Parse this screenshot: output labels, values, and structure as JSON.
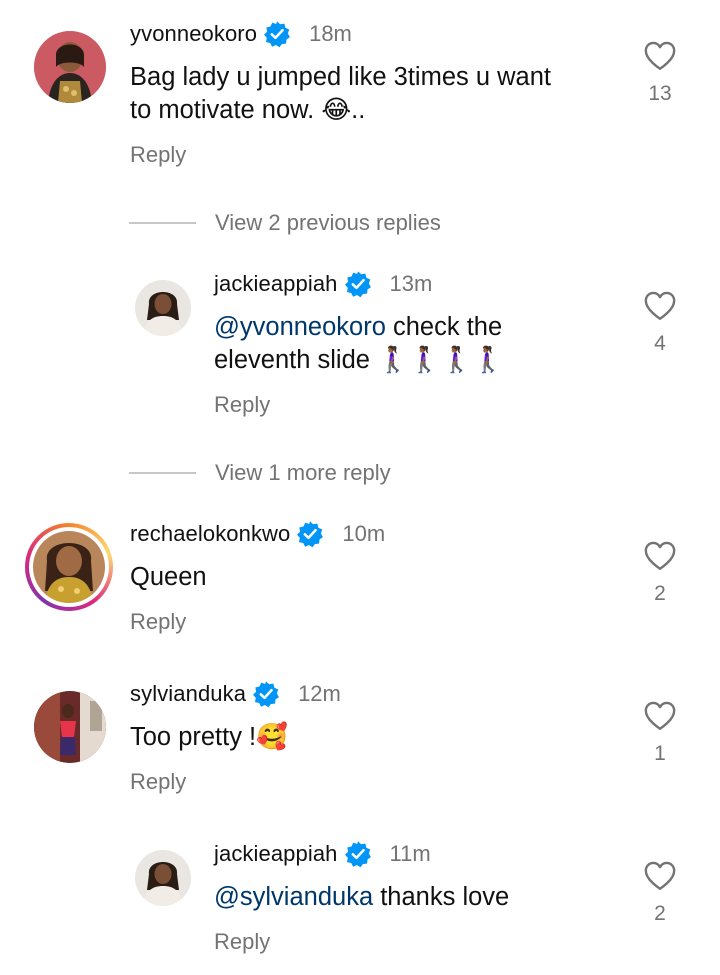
{
  "comments": [
    {
      "username": "yvonneokoro",
      "time": "18m",
      "text_line1": "Bag lady u jumped like 3times u want",
      "text_line2": "to motivate now. 😂..",
      "reply": "Reply",
      "likes": "13"
    },
    {
      "username": "jackieappiah",
      "time": "13m",
      "mention": "@yvonneokoro",
      "text_line1_rest": " check the",
      "text_line2": "eleventh slide 🚶🏾‍♀️🚶🏾‍♀️🚶🏾‍♀️🚶🏾‍♀️",
      "reply": "Reply",
      "likes": "4"
    },
    {
      "username": "rechaelokonkwo",
      "time": "10m",
      "text": "Queen",
      "reply": "Reply",
      "likes": "2"
    },
    {
      "username": "sylvianduka",
      "time": "12m",
      "text": "Too pretty !🥰",
      "reply": "Reply",
      "likes": "1"
    },
    {
      "username": "jackieappiah",
      "time": "11m",
      "mention": "@sylvianduka",
      "text_rest": " thanks love",
      "reply": "Reply",
      "likes": "2"
    }
  ],
  "view_previous": "View 2 previous replies",
  "view_more": "View 1 more reply",
  "colors": {
    "verified": "#0095f6",
    "mention": "#00376b",
    "secondary": "#737373"
  },
  "icons": {
    "like": "heart-outline-icon",
    "verified": "verified-badge-icon"
  }
}
